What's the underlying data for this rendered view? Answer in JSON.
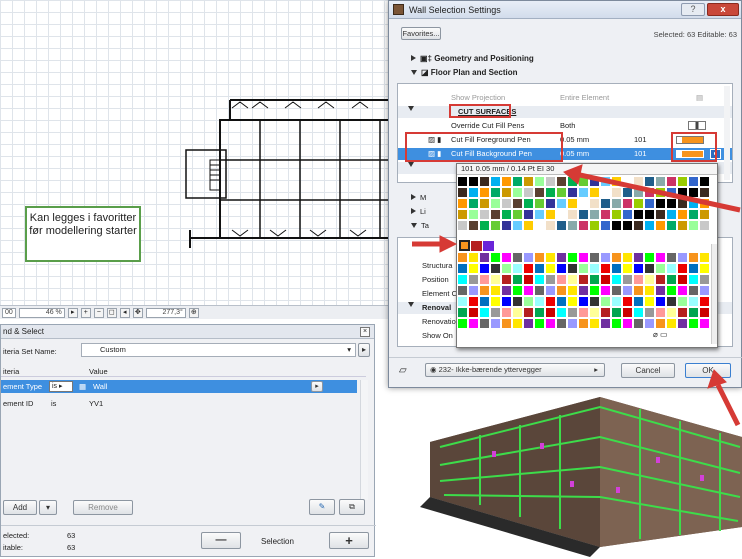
{
  "callout": {
    "text": "Kan legges i favoritter før modellering starter"
  },
  "statusbar": {
    "val1": "00",
    "zoom": "46 %",
    "angle": "277,3°"
  },
  "find_select": {
    "title": "nd & Select",
    "criteria_set_label": "iteria Set Name:",
    "criteria_set_value": "Custom",
    "col_criteria": "iteria",
    "col_value": "Value",
    "rows": [
      {
        "criteria": "ement Type",
        "op": "is",
        "value": "Wall"
      },
      {
        "criteria": "ement ID",
        "op": "is",
        "value": "YV1"
      }
    ],
    "add_label": "Add",
    "remove_label": "Remove",
    "selected_label": "elected:",
    "selected_value": "63",
    "editable_label": "itable:",
    "editable_value": "63",
    "selection_label": "Selection",
    "minus": "—",
    "plus": "+"
  },
  "dialog": {
    "title": "Wall Selection Settings",
    "help": "?",
    "close": "x",
    "favorites_label": "Favorites...",
    "selected_info": "Selected: 63 Editable: 63",
    "sections": {
      "geometry": "Geometry and Positioning",
      "floor_plan": "Floor Plan and Section"
    },
    "props": {
      "show_projection": "Show Projection",
      "show_projection_value": "Entire Element",
      "cut_surfaces": "CUT SURFACES",
      "override_pens": "Override Cut Fill Pens",
      "override_value": "Both",
      "fg_pen": "Cut Fill Foreground Pen",
      "fg_value": "0.05 mm",
      "fg_num": "101",
      "bg_pen": "Cut Fill Background Pen",
      "bg_value": "0.05 mm",
      "bg_num": "101"
    },
    "pen_info": "101  0.05 mm  /  0.14 Pt  EI 30",
    "hidden_rows": [
      "M",
      "Li",
      "Ta",
      "",
      "Structura",
      "Position",
      "Element C",
      "Renoval",
      "Renovatio",
      "Show On"
    ],
    "footer_layer": "232- Ikke-bærende yttervegger",
    "cancel_label": "Cancel",
    "ok_label": "OK"
  },
  "colors": {
    "accent": "#3e8fe0",
    "red_highlight": "#d63a35",
    "callout_border": "#5a9e4a"
  }
}
